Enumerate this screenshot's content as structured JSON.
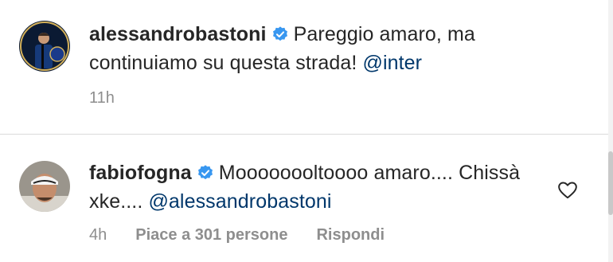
{
  "caption": {
    "username": "alessandrobastoni",
    "text": "Pareggio amaro, ma continuiamo su questa strada!",
    "mention": "@inter",
    "time": "11h"
  },
  "comment": {
    "username": "fabiofogna",
    "text": "Moooooooltoooo amaro.... Chissà xke....",
    "mention": "@alessandrobastoni",
    "time": "4h",
    "likes": "Piace a 301 persone",
    "reply": "Rispondi"
  },
  "icons": {
    "verified": "verified-badge-icon",
    "heart": "heart-outline-icon"
  },
  "colors": {
    "verified": "#3897f0",
    "mention": "#00376b",
    "meta": "#8e8e8e"
  }
}
